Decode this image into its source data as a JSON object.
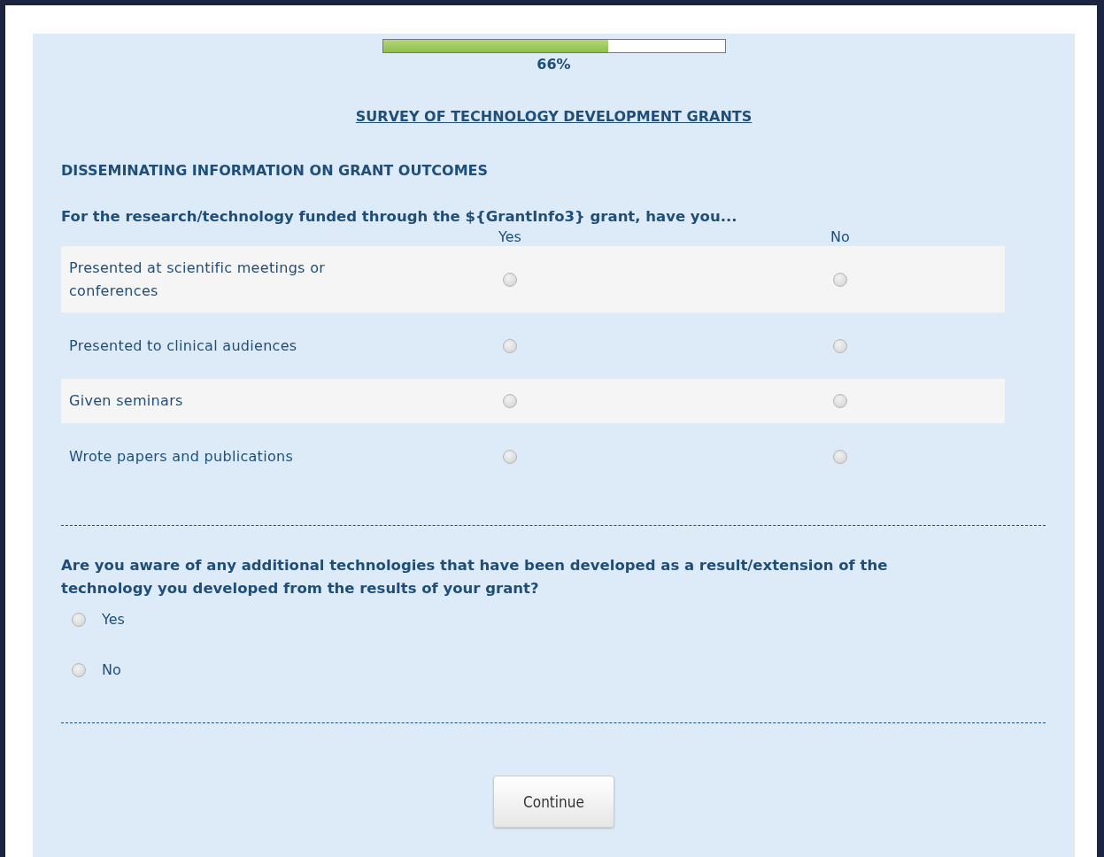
{
  "progress": {
    "level": 0.66,
    "label": "66%"
  },
  "title": "SURVEY OF TECHNOLOGY DEVELOPMENT GRANTS",
  "section_heading": "DISSEMINATING INFORMATION ON GRANT OUTCOMES",
  "matrix": {
    "question": "For the research/technology funded through the ${GrantInfo3} grant, have you...",
    "columns": [
      "Yes",
      "No"
    ],
    "rows": [
      {
        "label": "Presented at scientific meetings or conferences",
        "options": [
          {
            "selected": false
          },
          {
            "selected": false
          }
        ]
      },
      {
        "label": "Presented to clinical audiences",
        "options": [
          {
            "selected": false
          },
          {
            "selected": false
          }
        ]
      },
      {
        "label": "Given seminars",
        "options": [
          {
            "selected": false
          },
          {
            "selected": false
          }
        ]
      },
      {
        "label": "Wrote papers and publications",
        "options": [
          {
            "selected": false
          },
          {
            "selected": false
          }
        ]
      }
    ]
  },
  "choice_question": {
    "question": "Are you aware of any additional technologies that have been developed as a result/extension of the technology you developed from the results of your grant?",
    "options": [
      {
        "label": "Yes",
        "selected": false
      },
      {
        "label": "No",
        "selected": false
      }
    ]
  },
  "continue_button": "Continue"
}
